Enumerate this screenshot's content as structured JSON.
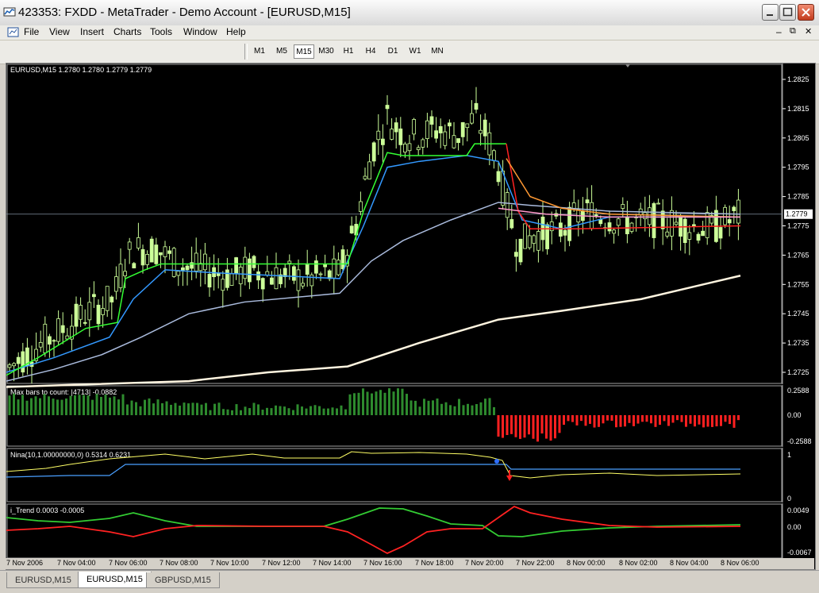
{
  "window": {
    "title": "423353: FXDD - MetaTrader - Demo Account - [EURUSD,M15]",
    "controls": {
      "minimize": "_",
      "maximize": "□",
      "close": "✕"
    },
    "child_controls": {
      "minimize": "–",
      "restore": "⧉",
      "close": "✕"
    }
  },
  "menu": {
    "items": [
      "File",
      "View",
      "Insert",
      "Charts",
      "Tools",
      "Window",
      "Help"
    ]
  },
  "timeframes": {
    "items": [
      "M1",
      "M5",
      "M15",
      "M30",
      "H1",
      "H4",
      "D1",
      "W1",
      "MN"
    ],
    "active": "M15"
  },
  "chart": {
    "header": "EURUSD,M15  1.2780 1.2780 1.2779 1.2779",
    "current_price": "1.2779",
    "price_ticks": [
      "1.2825",
      "1.2815",
      "1.2805",
      "1.2795",
      "1.2785",
      "1.2775",
      "1.2765",
      "1.2755",
      "1.2745",
      "1.2735",
      "1.2725"
    ],
    "panels": {
      "bars": {
        "label": "Max bars to count: |4713|  -0.0882",
        "ticks": [
          "0.2588",
          "0.00",
          "-0.2588"
        ]
      },
      "nina": {
        "label": "Nina(10,1.00000000,0) 0.5314 0.6231",
        "ticks": [
          "1",
          "0"
        ]
      },
      "itrend": {
        "label": "i_Trend 0.0003 -0.0005",
        "ticks": [
          "0.0049",
          "0.00",
          "-0.0067"
        ]
      }
    },
    "time_ticks": [
      "7 Nov 2006",
      "7 Nov 04:00",
      "7 Nov 06:00",
      "7 Nov 08:00",
      "7 Nov 10:00",
      "7 Nov 12:00",
      "7 Nov 14:00",
      "7 Nov 16:00",
      "7 Nov 18:00",
      "7 Nov 20:00",
      "7 Nov 22:00",
      "8 Nov 00:00",
      "8 Nov 02:00",
      "8 Nov 04:00",
      "8 Nov 06:00"
    ],
    "colors": {
      "background": "#000000",
      "candle": "#ccff99",
      "green_line": "#33ff33",
      "blue_line": "#3399ff",
      "light_blue_line": "#aabbdd",
      "white_line": "#fff5e0",
      "red_line": "#ff2222",
      "orange_line": "#ff9933",
      "pink_line": "#ff99cc",
      "bar_positive": "#2e8b2e",
      "bar_negative": "#ff2020",
      "nina_yellow": "#ffff66",
      "nina_blue": "#4a9fff",
      "trend_green": "#33cc33",
      "trend_red": "#ff2222"
    }
  },
  "tabs": {
    "items": [
      "EURUSD,M15",
      "EURUSD,M15",
      "GBPUSD,M15"
    ],
    "active_index": 1
  }
}
